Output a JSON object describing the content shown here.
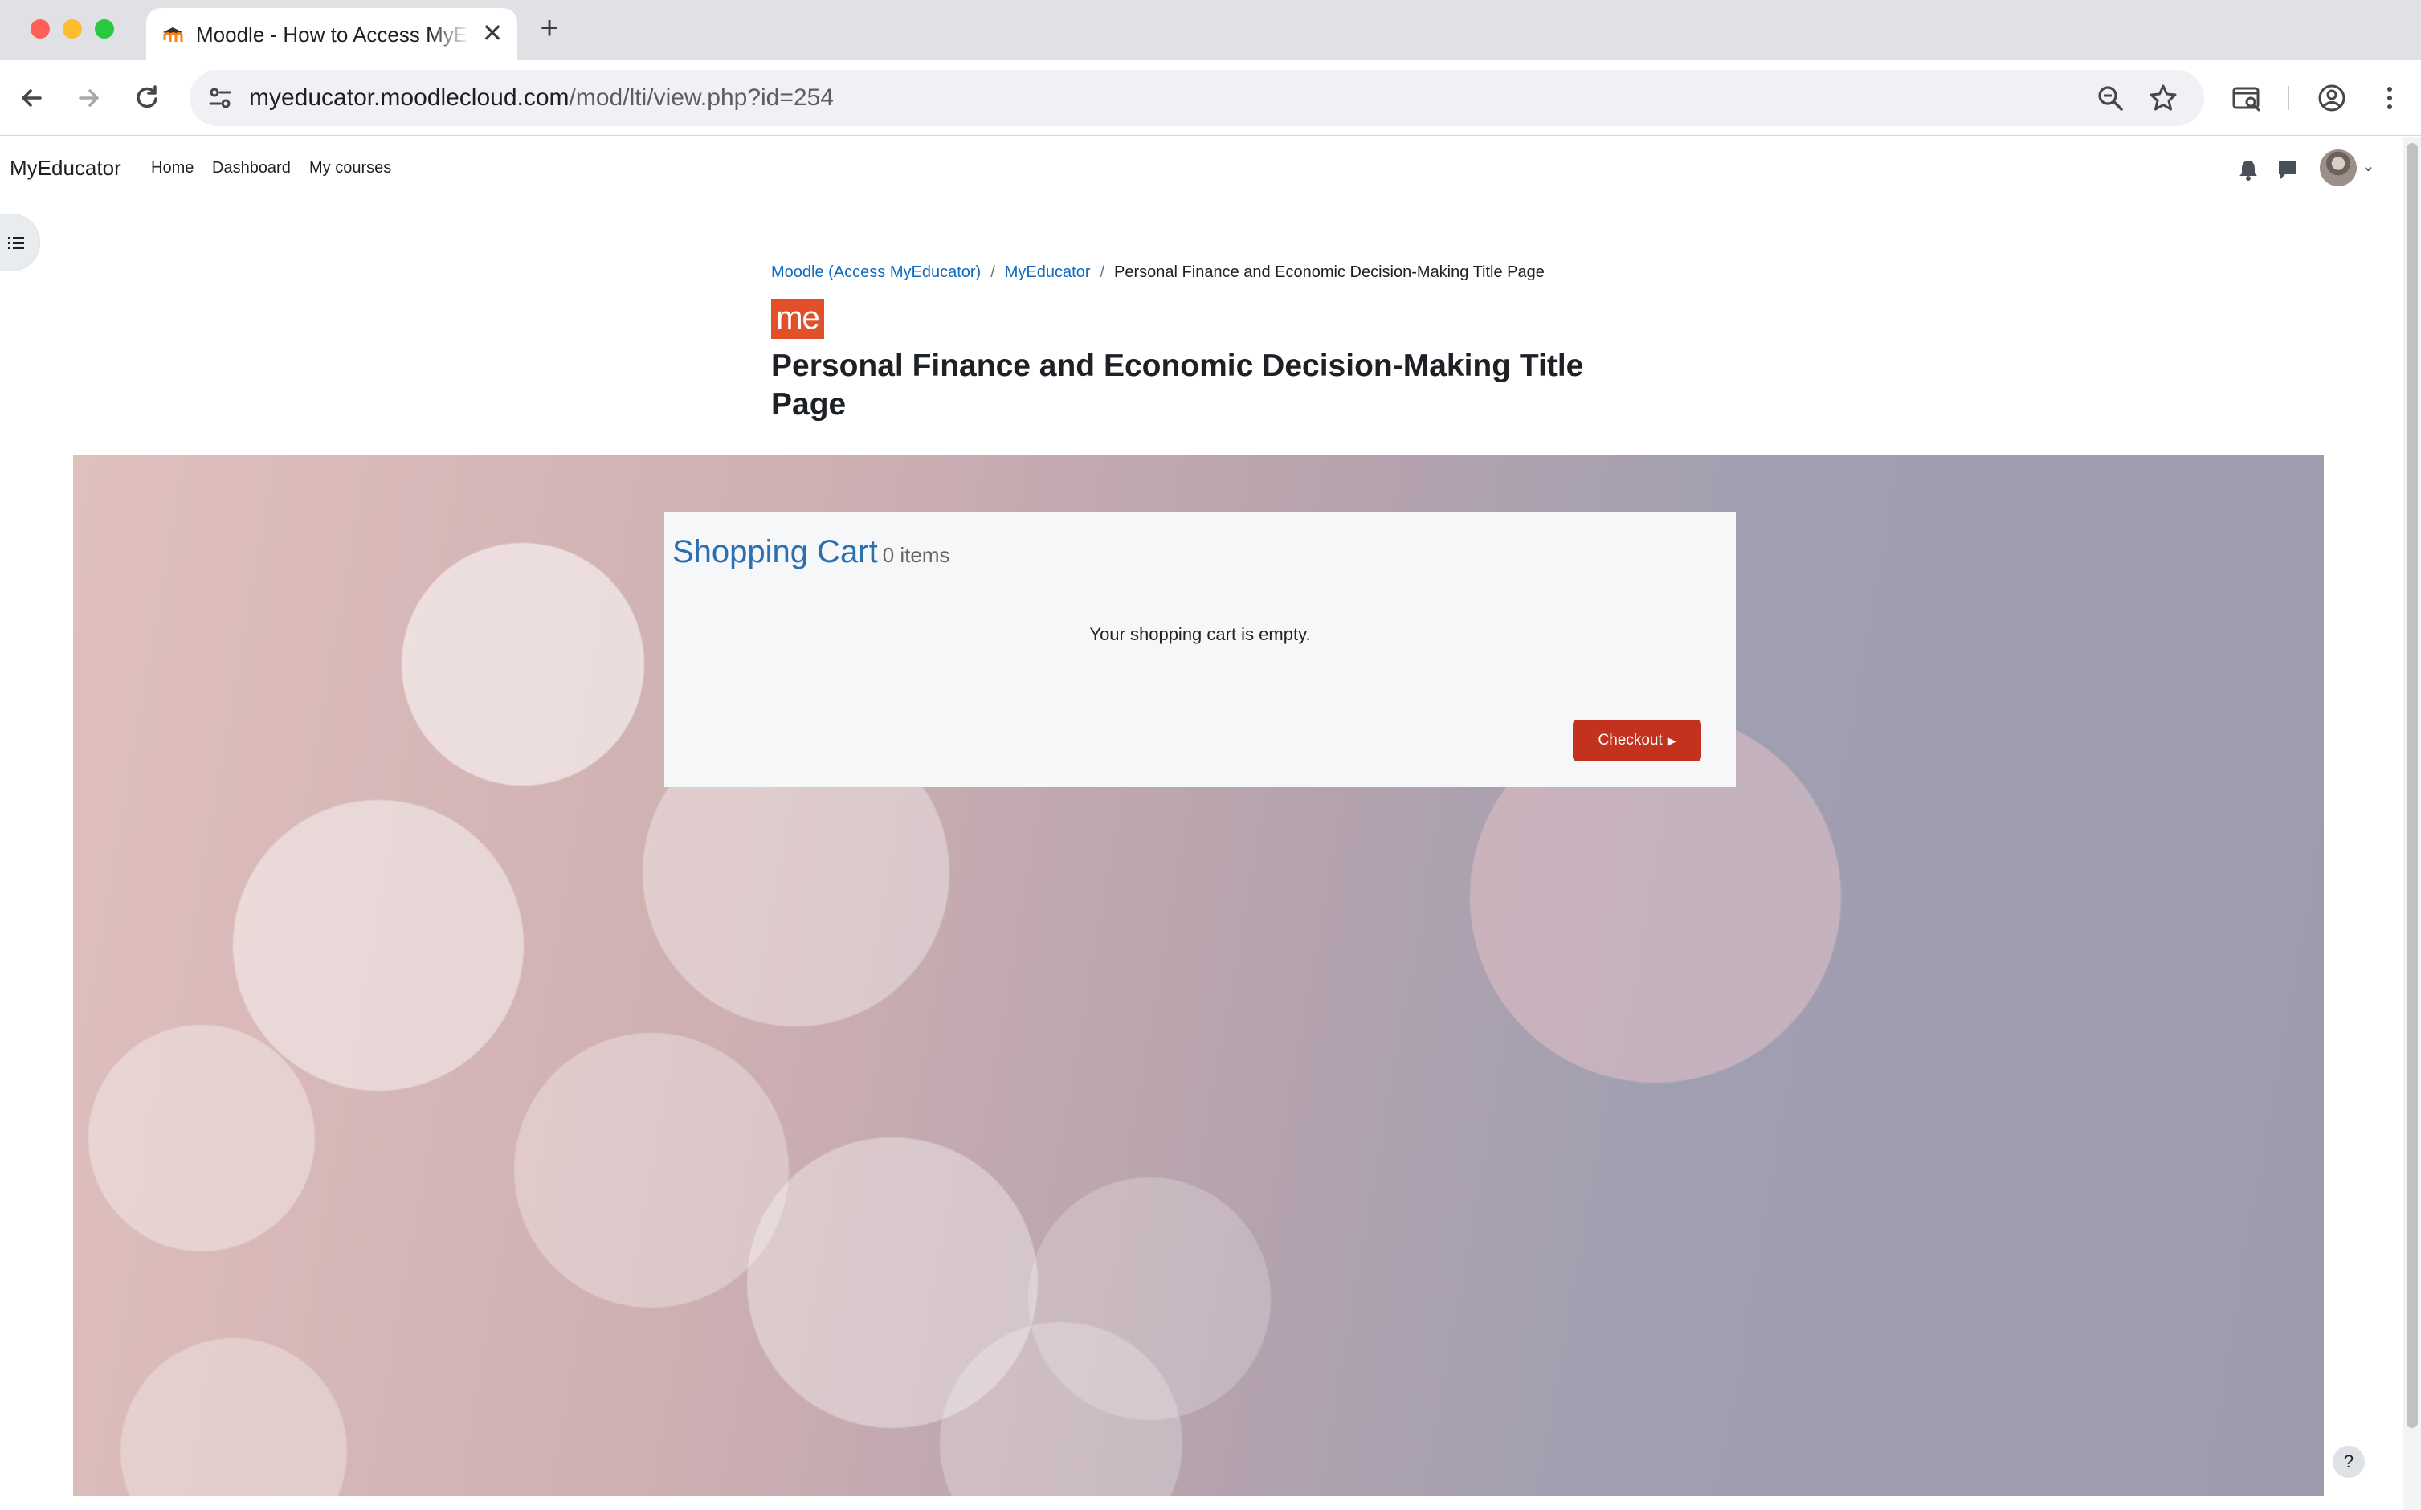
{
  "browser": {
    "tab_title": "Moodle - How to Access MyE",
    "new_tab_label": "+",
    "close_label": "✕",
    "url_host": "myeducator.moodlecloud.com",
    "url_path": "/mod/lti/view.php?id=254"
  },
  "navbar": {
    "brand": "MyEducator",
    "links": [
      "Home",
      "Dashboard",
      "My courses"
    ]
  },
  "breadcrumb": {
    "items": [
      "Moodle (Access MyEducator)",
      "MyEducator",
      "Personal Finance and Economic Decision-Making Title Page"
    ],
    "separator": "/"
  },
  "logo_text": "me",
  "page_title": "Personal Finance and Economic Decision-Making Title Page",
  "cart": {
    "title": "Shopping Cart",
    "count": "0 items",
    "empty_message": "Your shopping cart is empty.",
    "checkout_label": "Checkout"
  },
  "help_label": "?",
  "colors": {
    "link": "#0f6cbf",
    "checkout": "#c2321f",
    "logo": "#e2502a",
    "cart_title": "#2a6fb0"
  }
}
